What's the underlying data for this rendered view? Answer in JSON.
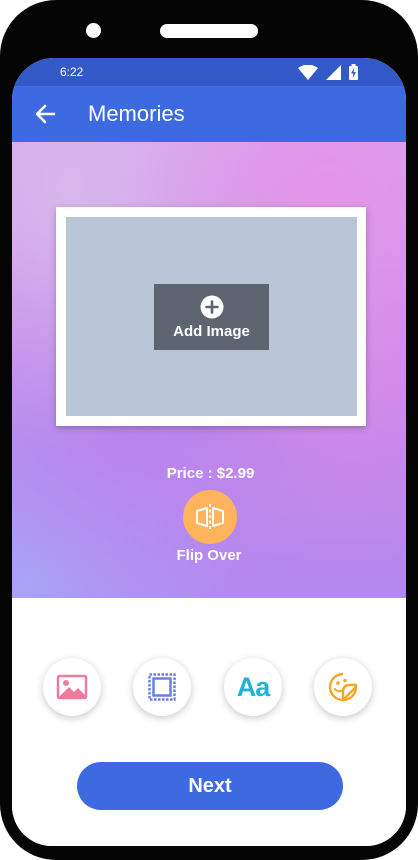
{
  "status_bar": {
    "time": "6:22",
    "icons": [
      "wifi-icon",
      "cellular-signal-icon",
      "battery-charging-icon"
    ]
  },
  "app_bar": {
    "title": "Memories",
    "back_icon": "arrow-left-icon"
  },
  "card": {
    "add_image_label": "Add Image",
    "add_image_icon": "plus-circle-icon",
    "price": "Price : $2.99",
    "flip_label": "Flip Over",
    "flip_icon": "flip-icon"
  },
  "tools": [
    {
      "name": "image",
      "icon": "image-icon",
      "color": "#f07a9a"
    },
    {
      "name": "frame",
      "icon": "frame-icon",
      "color": "#6b7ee8"
    },
    {
      "name": "text",
      "icon": "text-icon",
      "label": "Aa",
      "color": "#23b1d8"
    },
    {
      "name": "sticker",
      "icon": "sticker-icon",
      "color": "#f5a623"
    }
  ],
  "next_button": {
    "label": "Next"
  },
  "colors": {
    "status_bar": "#3358c8",
    "primary": "#3e6ae1",
    "flip_button": "#ffb35c",
    "photo_slot": "#b8c6d8",
    "add_image_button": "#5d6670"
  }
}
